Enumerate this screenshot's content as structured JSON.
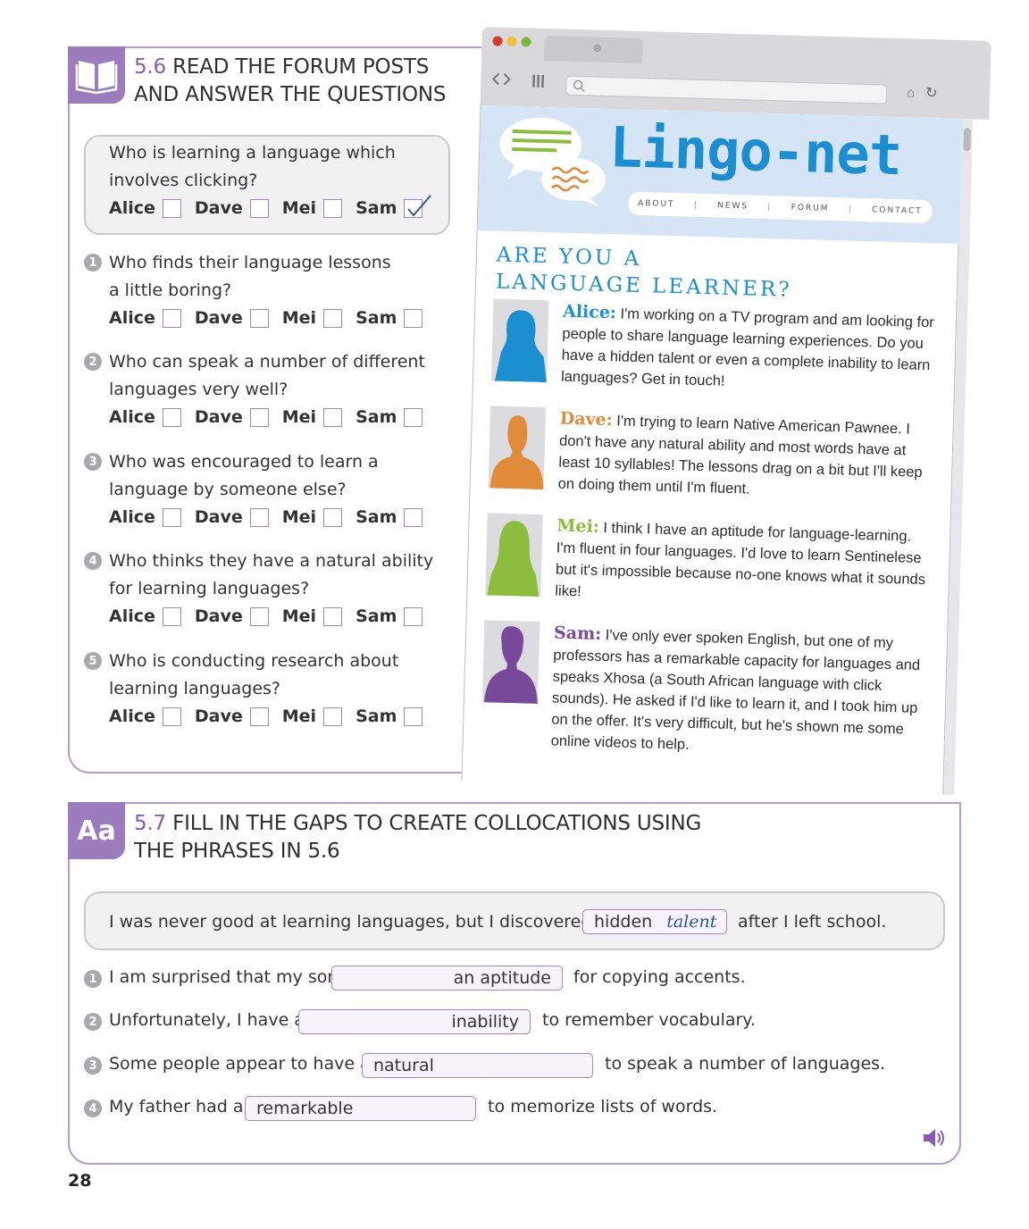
{
  "section_56": {
    "number": "5.6",
    "title_line1": "READ THE FORUM POSTS",
    "title_line2": "AND ANSWER THE QUESTIONS",
    "example": {
      "line1": "Who is learning a language which",
      "line2": "involves clicking?",
      "checked": "Sam"
    },
    "options": [
      "Alice",
      "Dave",
      "Mei",
      "Sam"
    ],
    "questions": [
      {
        "num": "1",
        "line1": "Who finds their language lessons",
        "line2": "a little boring?"
      },
      {
        "num": "2",
        "line1": "Who can speak a number of different",
        "line2": "languages very well?"
      },
      {
        "num": "3",
        "line1": "Who was encouraged to learn a",
        "line2": "language by someone else?"
      },
      {
        "num": "4",
        "line1": "Who thinks they have a natural ability",
        "line2": "for learning languages?"
      },
      {
        "num": "5",
        "line1": "Who is conducting research about",
        "line2": "learning languages?"
      }
    ]
  },
  "browser": {
    "logo": "Lingo-net",
    "nav": [
      "ABOUT",
      "NEWS",
      "FORUM",
      "CONTACT"
    ],
    "heading_line1": "ARE YOU A",
    "heading_line2": "LANGUAGE LEARNER?",
    "posts": [
      {
        "name": "Alice:",
        "color": "#1b8ed1",
        "text": "I'm working on a TV program and am looking for people to share language learning experiences. Do you have a hidden talent or even a complete inability to learn languages? Get in touch!"
      },
      {
        "name": "Dave:",
        "color": "#e08b3a",
        "text": "I'm trying to learn Native American Pawnee. I don't have any natural ability and most words have at least 10 syllables! The lessons drag on a bit but I'll keep on doing them until I'm fluent."
      },
      {
        "name": "Mei:",
        "color": "#8cbd3c",
        "text": "I think I have an aptitude for language-learning. I'm fluent in four languages. I'd love to learn Sentinelese but it's impossible because no-one knows what it sounds like!"
      },
      {
        "name": "Sam:",
        "color": "#7a4a9a",
        "text": "I've only ever spoken English, but one of my professors has a remarkable capacity for languages and speaks Xhosa (a South African language with click sounds). He asked if I'd like to learn it, and I took him up on the offer. It's very difficult, but he's shown me some online videos to help."
      }
    ]
  },
  "section_57": {
    "tab_label": "Aa",
    "number": "5.7",
    "title_line1": "FILL IN THE GAPS TO CREATE COLLOCATIONS USING",
    "title_line2": "THE PHRASES IN 5.6",
    "example": {
      "before": "I was never good at learning languages, but I discovered a",
      "gap_printed": "hidden",
      "gap_answer": "talent",
      "after": "after I left school."
    },
    "sentences": [
      {
        "num": "1",
        "before": "I am surprised that my son",
        "gap": "an aptitude",
        "after": "for copying accents."
      },
      {
        "num": "2",
        "before": "Unfortunately, I have a",
        "gap": "inability",
        "after": "to remember vocabulary."
      },
      {
        "num": "3",
        "before": "Some people appear to have a",
        "gap": "natural",
        "after": "to speak a number of languages."
      },
      {
        "num": "4",
        "before": "My father had a",
        "gap": "remarkable",
        "after": "to memorize lists of words."
      }
    ]
  },
  "page_number": "28",
  "colors": {
    "accent": "#9c7cbd",
    "brand": "#1b8ed1"
  }
}
